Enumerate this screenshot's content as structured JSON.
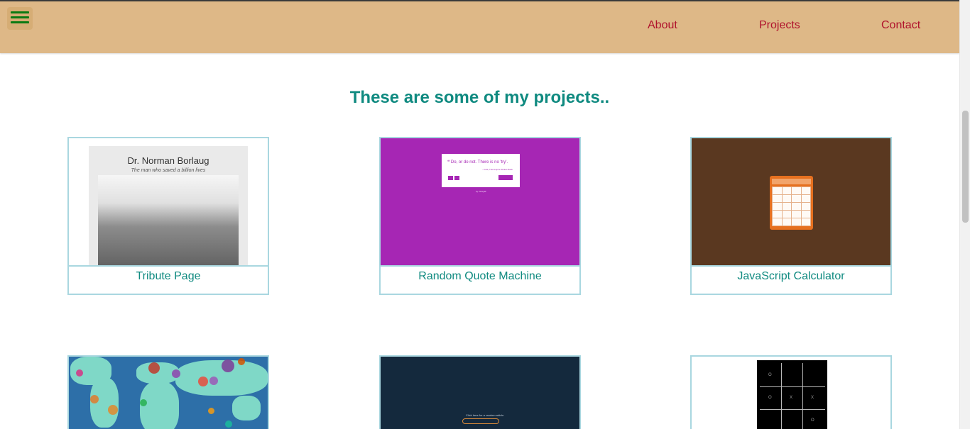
{
  "nav": {
    "menu_icon": "hamburger-menu-icon",
    "links": [
      {
        "label": "About"
      },
      {
        "label": "Projects"
      },
      {
        "label": "Contact"
      }
    ]
  },
  "main": {
    "heading": "These are some of my projects.."
  },
  "projects": [
    {
      "label": "Tribute Page",
      "thumb": {
        "title": "Dr. Norman Borlaug",
        "subtitle": "The man who saved a billion lives"
      }
    },
    {
      "label": "Random Quote Machine",
      "thumb": {
        "quote": "❝ Do, or do not. There is no 'try'.",
        "author": "- Yoda, The Empire Strikes Back",
        "button": "New quote",
        "footer": "by Vinayak"
      }
    },
    {
      "label": "JavaScript Calculator"
    },
    {
      "label": ""
    },
    {
      "label": "",
      "thumb": {
        "text": "Click here for a random article"
      }
    },
    {
      "label": "",
      "thumb": {
        "marks": [
          "O",
          "O",
          "X",
          "X",
          "O"
        ]
      }
    }
  ],
  "colors": {
    "header_bg": "#deb887",
    "nav_link": "#b0122c",
    "heading": "#0f8a80",
    "card_border": "#a9d7e0",
    "menu_icon": "#0a7a12"
  },
  "scroll": {
    "position_fraction": 0.26
  }
}
